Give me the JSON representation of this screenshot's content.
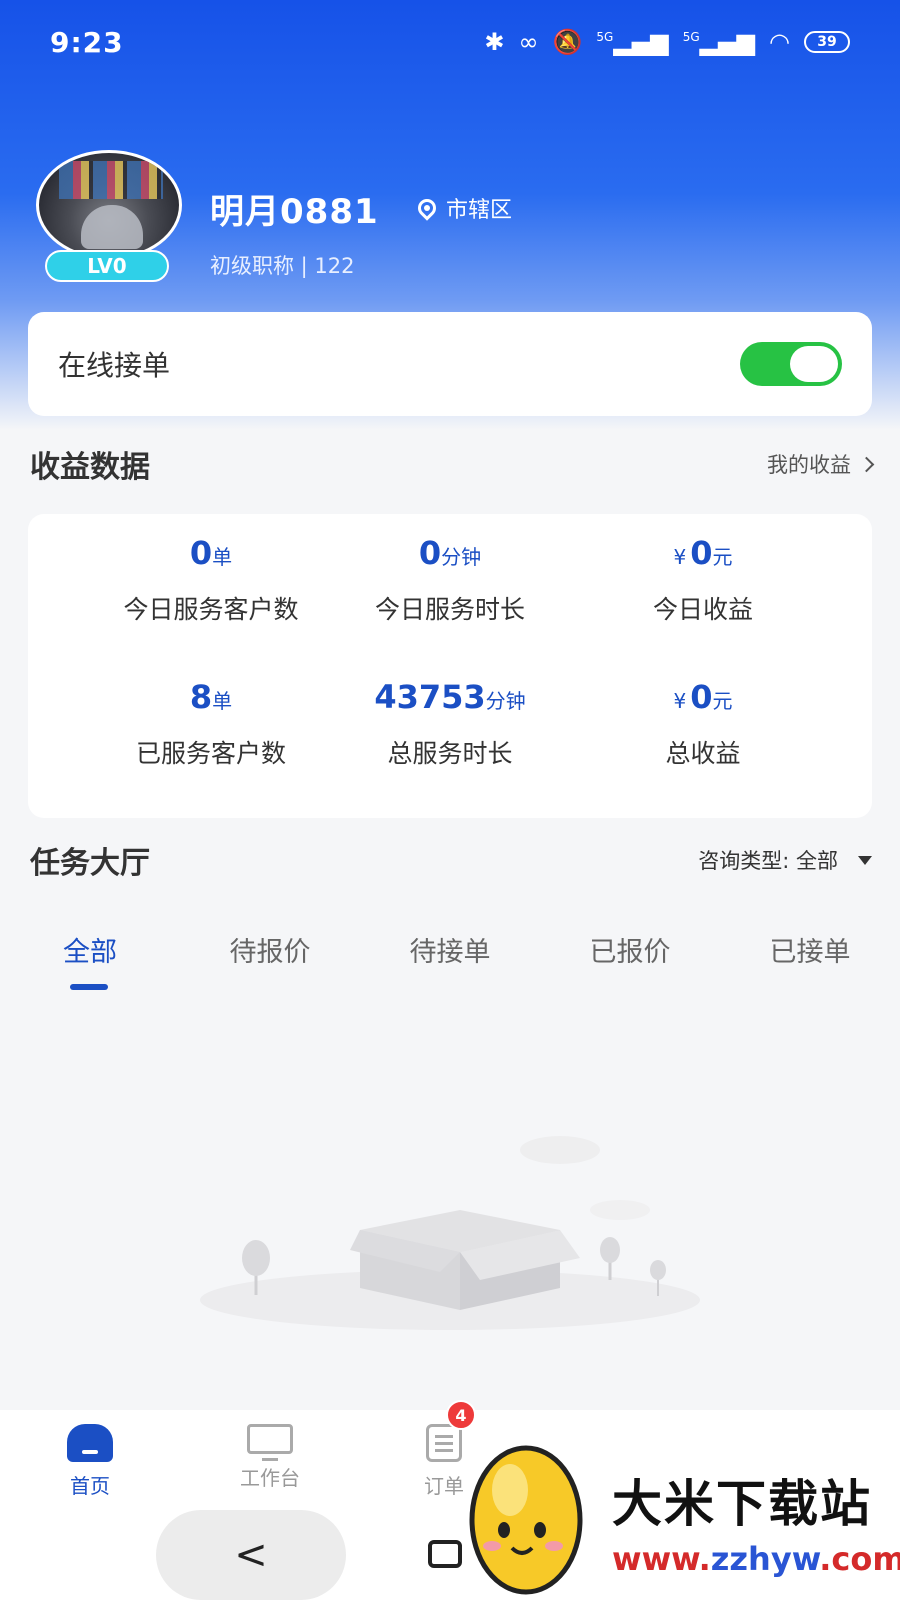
{
  "status_bar": {
    "time": "9:23",
    "signal_1": "5G",
    "signal_2": "5G",
    "battery": "39"
  },
  "profile": {
    "name": "明月0881",
    "location": "市辖区",
    "level": "LV0",
    "title_line": "初级职称 | 122"
  },
  "online": {
    "label": "在线接单",
    "enabled": true
  },
  "earnings": {
    "title": "收益数据",
    "link": "我的收益",
    "stats": [
      {
        "value": "0",
        "unit": "单",
        "currency": "",
        "label": "今日服务客户数"
      },
      {
        "value": "0",
        "unit": "分钟",
        "currency": "",
        "label": "今日服务时长"
      },
      {
        "value": "0",
        "unit": "元",
        "currency": "¥",
        "label": "今日收益"
      },
      {
        "value": "8",
        "unit": "单",
        "currency": "",
        "label": "已服务客户数"
      },
      {
        "value": "43753",
        "unit": "分钟",
        "currency": "",
        "label": "总服务时长"
      },
      {
        "value": "0",
        "unit": "元",
        "currency": "¥",
        "label": "总收益"
      }
    ]
  },
  "task_hall": {
    "title": "任务大厅",
    "filter_label": "咨询类型: 全部",
    "tabs": [
      "全部",
      "待报价",
      "待接单",
      "已报价",
      "已接单"
    ],
    "active_tab": 0
  },
  "bottom_nav": {
    "items": [
      "首页",
      "工作台",
      "订单"
    ],
    "order_badge": "4"
  },
  "gesture_bar": {
    "back": "<"
  },
  "watermark": {
    "name": "大米下载站",
    "url_prefix": "www.",
    "url_mid": "zzhyw",
    "url_suffix": ".com"
  },
  "colors": {
    "accent": "#1b4fc4",
    "toggle_on": "#27c244",
    "badge": "#ee3a3a",
    "header_blue": "#1652e8"
  }
}
